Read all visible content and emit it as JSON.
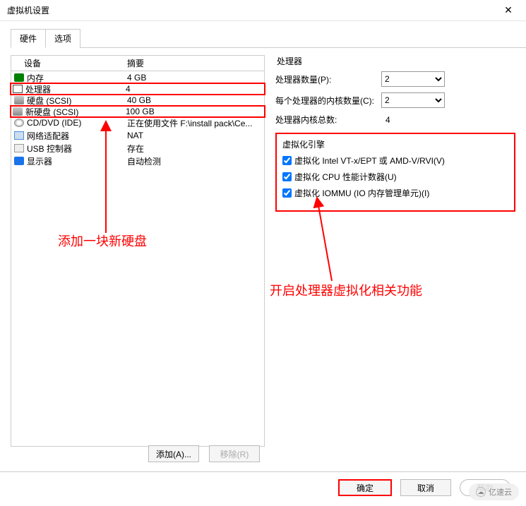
{
  "window": {
    "title": "虚拟机设置"
  },
  "tabs": {
    "hardware": "硬件",
    "options": "选项"
  },
  "list_header": {
    "device": "设备",
    "summary": "摘要"
  },
  "devices": [
    {
      "name": "内存",
      "summary": "4 GB",
      "icon": "mem"
    },
    {
      "name": "处理器",
      "summary": "4",
      "icon": "cpu",
      "highlight": true
    },
    {
      "name": "硬盘 (SCSI)",
      "summary": "40 GB",
      "icon": "disk"
    },
    {
      "name": "新硬盘 (SCSI)",
      "summary": "100 GB",
      "icon": "disk",
      "highlight": true
    },
    {
      "name": "CD/DVD (IDE)",
      "summary": "正在使用文件 F:\\install pack\\Ce...",
      "icon": "cd"
    },
    {
      "name": "网络适配器",
      "summary": "NAT",
      "icon": "net"
    },
    {
      "name": "USB 控制器",
      "summary": "存在",
      "icon": "usb"
    },
    {
      "name": "显示器",
      "summary": "自动检测",
      "icon": "display"
    }
  ],
  "proc": {
    "title": "处理器",
    "count_label": "处理器数量(P):",
    "count_value": "2",
    "cores_label": "每个处理器的内核数量(C):",
    "cores_value": "2",
    "total_label": "处理器内核总数:",
    "total_value": "4"
  },
  "virt": {
    "title": "虚拟化引擎",
    "vt": "虚拟化 Intel VT-x/EPT 或 AMD-V/RVI(V)",
    "counters": "虚拟化 CPU 性能计数器(U)",
    "iommu": "虚拟化 IOMMU (IO 内存管理单元)(I)"
  },
  "annotations": {
    "add_disk": "添加一块新硬盘",
    "enable_virt": "开启处理器虚拟化相关功能"
  },
  "buttons": {
    "add": "添加(A)...",
    "remove": "移除(R)",
    "ok": "确定",
    "cancel": "取消",
    "help": "帮助"
  },
  "watermark": "亿速云"
}
